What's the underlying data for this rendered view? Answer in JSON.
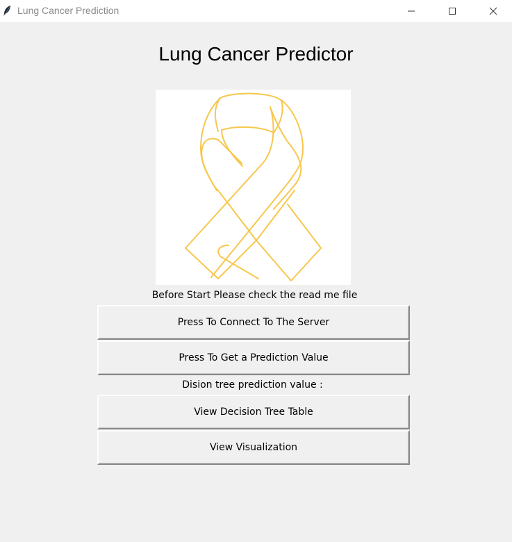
{
  "window": {
    "title": "Lung Cancer Prediction",
    "icon": "feather-icon"
  },
  "main": {
    "heading": "Lung Cancer Predictor",
    "image": {
      "icon": "awareness-ribbon-icon",
      "stroke_color": "#f7c74d",
      "background": "#ffffff"
    },
    "note": "Before Start Please check the read me file",
    "connect_button": "Press To Connect To The Server",
    "predict_button": "Press To Get a Prediction Value",
    "prediction_label": "Dision tree prediction value :",
    "table_button": "View Decision Tree Table",
    "visualization_button": "View Visualization"
  }
}
